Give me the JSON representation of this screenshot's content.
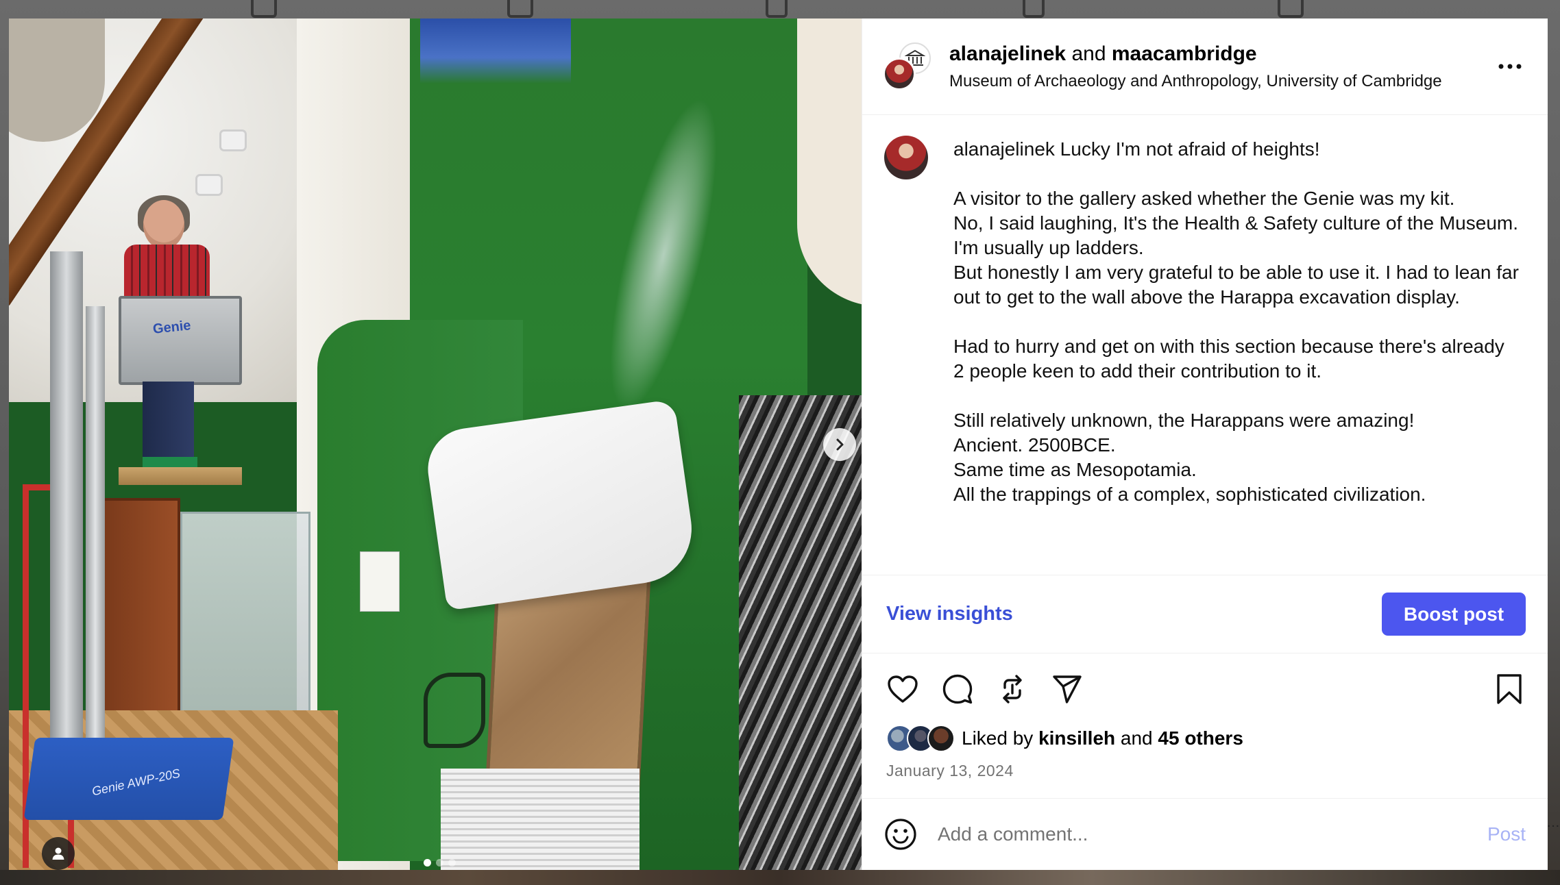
{
  "post": {
    "author": "alanajelinek",
    "collab_joiner": "and",
    "collaborator": "maacambridge",
    "location": "Museum of Archaeology and Anthropology, University of Cambridge",
    "more_icon": "more-horizontal-icon",
    "caption_user": "alanajelinek",
    "caption_body": " Lucky I'm not afraid of heights!\n\nA visitor to the gallery asked whether the Genie was my kit.\nNo, I said laughing, It's the Health & Safety culture of the Museum.\nI'm usually up ladders.\nBut honestly I am very grateful to be able to use it. I had to lean far out to get to the wall above the Harappa excavation display.\n\nHad to hurry and get on with this section because there's already 2 people keen to add their contribution to it.\n\nStill relatively unknown, the Harappans were amazing!\nAncient. 2500BCE.\nSame time as Mesopotamia.\nAll the trappings of a complex, sophisticated civilization.",
    "carousel": {
      "slide_count": 3,
      "active_slide": 1,
      "platform_label": "Genie",
      "lift_label": "Genie AWP-20S"
    }
  },
  "actions": {
    "view_insights": "View insights",
    "boost_post": "Boost post"
  },
  "feedback": {
    "icons": [
      "heart-icon",
      "comment-icon",
      "repost-icon",
      "share-icon",
      "bookmark-icon"
    ],
    "liked_by_prefix": "Liked by ",
    "liked_by_user": "kinsilleh",
    "liked_by_joiner": " and ",
    "liked_by_others": "45 others",
    "date": "January 13, 2024"
  },
  "comment": {
    "placeholder": "Add a comment...",
    "post_label": "Post"
  },
  "colors": {
    "accent": "#4c56ef",
    "link": "#3a4fd6",
    "post_disabled": "#a8b3f5",
    "secondary_text": "#737373"
  }
}
